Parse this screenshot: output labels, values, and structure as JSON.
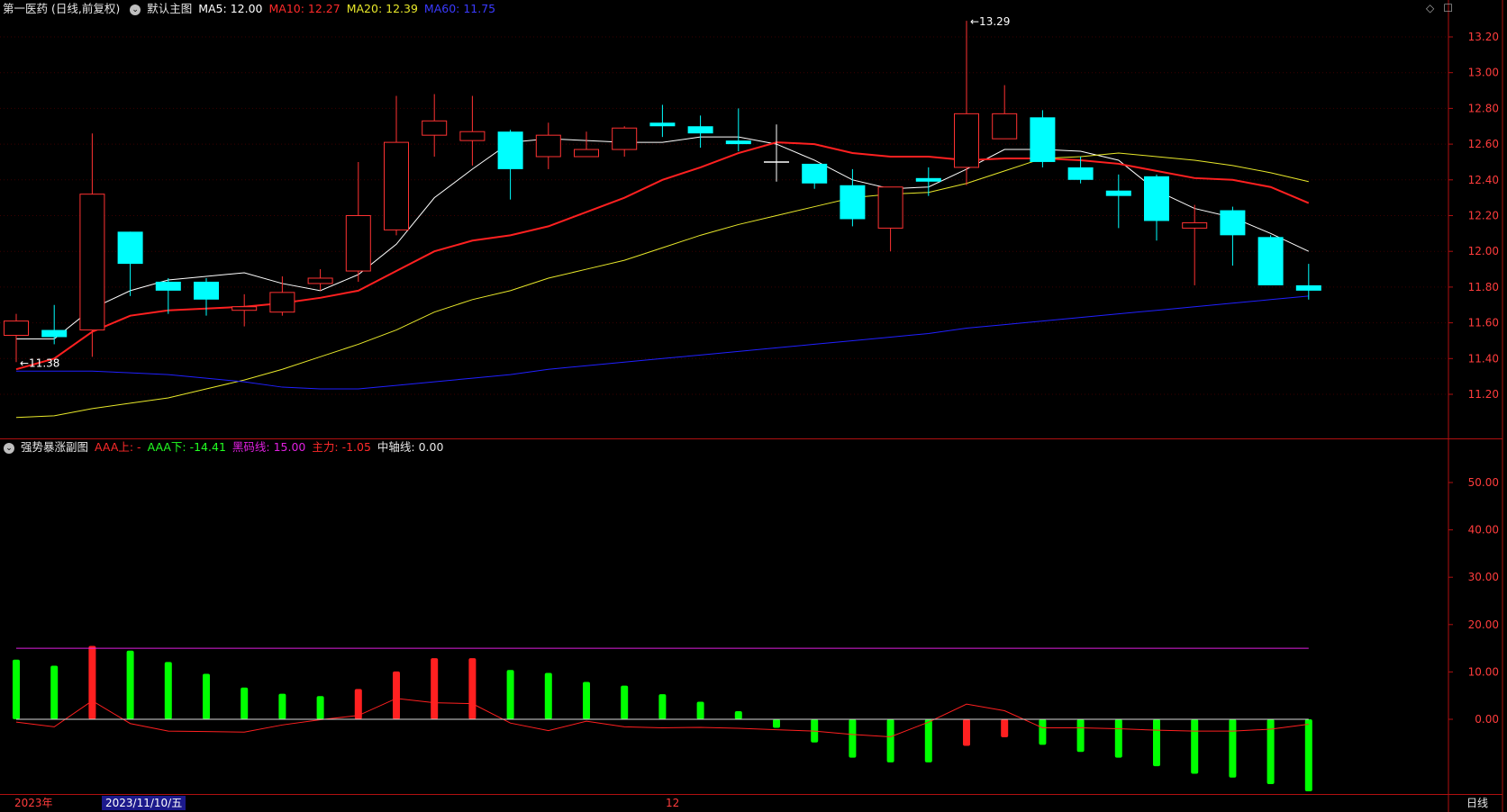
{
  "main_header": {
    "title": "第一医药 (日线,前复权)",
    "panel": "默认主图",
    "ma5": "MA5: 12.00",
    "ma10": "MA10: 12.27",
    "ma20": "MA20: 12.39",
    "ma60": "MA60: 11.75"
  },
  "sub_header": {
    "title": "强势暴涨副图",
    "aaa_up": "AAA上: -",
    "aaa_down": "AAA下: -14.41",
    "black_horse": "黑码线: 15.00",
    "main_force": "主力: -1.05",
    "mid_axis": "中轴线: 0.00"
  },
  "icons": [
    "diamond-icon",
    "square-icon"
  ],
  "x_axis": {
    "left": "2023年",
    "selected": "2023/11/10/五",
    "mid": "12",
    "right_tab": "日线"
  },
  "colors": {
    "up": "#ff3232",
    "down": "#00ffff",
    "ma5": "#ffffff",
    "ma10": "#ff2020",
    "ma20": "#e8e82a",
    "ma60": "#2020ff",
    "hist_up": "#ff2020",
    "hist_down": "#00ff00",
    "black_horse": "#e020e0",
    "axis_text": "#ff3c3c",
    "frame": "#b01010"
  },
  "chart_data": [
    {
      "type": "candlestick",
      "y_ticks": [
        "13.20",
        "13.00",
        "12.80",
        "12.60",
        "12.40",
        "12.20",
        "12.00",
        "11.80",
        "11.60",
        "11.40",
        "11.20"
      ],
      "ylim": [
        11.0,
        13.35
      ],
      "annotations": [
        {
          "label": "13.29",
          "index": 25,
          "price": 13.29
        },
        {
          "label": "11.38",
          "index": 0,
          "price": 11.38
        }
      ],
      "candles": [
        {
          "o": 11.53,
          "h": 11.65,
          "l": 11.38,
          "c": 11.61
        },
        {
          "o": 11.56,
          "h": 11.7,
          "l": 11.48,
          "c": 11.52
        },
        {
          "o": 11.56,
          "h": 12.66,
          "l": 11.41,
          "c": 12.32
        },
        {
          "o": 12.11,
          "h": 12.11,
          "l": 11.75,
          "c": 11.93
        },
        {
          "o": 11.83,
          "h": 11.85,
          "l": 11.65,
          "c": 11.78
        },
        {
          "o": 11.83,
          "h": 11.85,
          "l": 11.64,
          "c": 11.73
        },
        {
          "o": 11.67,
          "h": 11.76,
          "l": 11.58,
          "c": 11.69
        },
        {
          "o": 11.66,
          "h": 11.86,
          "l": 11.64,
          "c": 11.77
        },
        {
          "o": 11.82,
          "h": 11.9,
          "l": 11.78,
          "c": 11.85
        },
        {
          "o": 11.89,
          "h": 12.5,
          "l": 11.83,
          "c": 12.2
        },
        {
          "o": 12.12,
          "h": 12.87,
          "l": 12.09,
          "c": 12.61
        },
        {
          "o": 12.65,
          "h": 12.88,
          "l": 12.53,
          "c": 12.73
        },
        {
          "o": 12.62,
          "h": 12.87,
          "l": 12.48,
          "c": 12.67
        },
        {
          "o": 12.67,
          "h": 12.68,
          "l": 12.29,
          "c": 12.46
        },
        {
          "o": 12.53,
          "h": 12.72,
          "l": 12.46,
          "c": 12.65
        },
        {
          "o": 12.53,
          "h": 12.67,
          "l": 12.53,
          "c": 12.57
        },
        {
          "o": 12.57,
          "h": 12.7,
          "l": 12.53,
          "c": 12.69
        },
        {
          "o": 12.72,
          "h": 12.82,
          "l": 12.64,
          "c": 12.7
        },
        {
          "o": 12.7,
          "h": 12.76,
          "l": 12.58,
          "c": 12.66
        },
        {
          "o": 12.62,
          "h": 12.8,
          "l": 12.56,
          "c": 12.6
        },
        {
          "o": 12.5,
          "h": 12.71,
          "l": 12.39,
          "c": 12.5
        },
        {
          "o": 12.49,
          "h": 12.49,
          "l": 12.35,
          "c": 12.38
        },
        {
          "o": 12.37,
          "h": 12.46,
          "l": 12.14,
          "c": 12.18
        },
        {
          "o": 12.13,
          "h": 12.36,
          "l": 12.0,
          "c": 12.36
        },
        {
          "o": 12.41,
          "h": 12.47,
          "l": 12.31,
          "c": 12.39
        },
        {
          "o": 12.47,
          "h": 13.29,
          "l": 12.37,
          "c": 12.77
        },
        {
          "o": 12.63,
          "h": 12.93,
          "l": 12.63,
          "c": 12.77
        },
        {
          "o": 12.75,
          "h": 12.79,
          "l": 12.47,
          "c": 12.5
        },
        {
          "o": 12.47,
          "h": 12.53,
          "l": 12.38,
          "c": 12.4
        },
        {
          "o": 12.34,
          "h": 12.43,
          "l": 12.13,
          "c": 12.31
        },
        {
          "o": 12.42,
          "h": 12.43,
          "l": 12.06,
          "c": 12.17
        },
        {
          "o": 12.13,
          "h": 12.26,
          "l": 11.81,
          "c": 12.16
        },
        {
          "o": 12.23,
          "h": 12.25,
          "l": 11.92,
          "c": 12.09
        },
        {
          "o": 12.08,
          "h": 12.09,
          "l": 11.81,
          "c": 11.81
        },
        {
          "o": 11.81,
          "h": 11.93,
          "l": 11.73,
          "c": 11.78
        }
      ],
      "series": [
        {
          "name": "MA5",
          "values": [
            11.51,
            11.51,
            11.68,
            11.78,
            11.84,
            11.86,
            11.88,
            11.82,
            11.78,
            11.87,
            12.04,
            12.3,
            12.46,
            12.61,
            12.63,
            12.62,
            12.61,
            12.61,
            12.64,
            12.64,
            12.6,
            12.51,
            12.4,
            12.35,
            12.36,
            12.46,
            12.57,
            12.57,
            12.56,
            12.51,
            12.34,
            12.24,
            12.19,
            12.1,
            12.0
          ]
        },
        {
          "name": "MA10",
          "values": [
            11.34,
            11.4,
            11.55,
            11.64,
            11.67,
            11.68,
            11.69,
            11.71,
            11.74,
            11.78,
            11.89,
            12.0,
            12.06,
            12.09,
            12.14,
            12.22,
            12.3,
            12.4,
            12.47,
            12.55,
            12.61,
            12.6,
            12.55,
            12.53,
            12.53,
            12.51,
            12.52,
            12.52,
            12.51,
            12.49,
            12.45,
            12.41,
            12.4,
            12.36,
            12.27
          ]
        },
        {
          "name": "MA20",
          "values": [
            11.07,
            11.08,
            11.12,
            11.15,
            11.18,
            11.23,
            11.28,
            11.34,
            11.41,
            11.48,
            11.56,
            11.66,
            11.73,
            11.78,
            11.85,
            11.9,
            11.95,
            12.02,
            12.09,
            12.15,
            12.2,
            12.25,
            12.3,
            12.32,
            12.33,
            12.38,
            12.45,
            12.52,
            12.53,
            12.55,
            12.53,
            12.51,
            12.48,
            12.44,
            12.39
          ]
        },
        {
          "name": "MA60",
          "values": [
            11.33,
            11.33,
            11.33,
            11.32,
            11.31,
            11.29,
            11.27,
            11.24,
            11.23,
            11.23,
            11.25,
            11.27,
            11.29,
            11.31,
            11.34,
            11.36,
            11.38,
            11.4,
            11.42,
            11.44,
            11.46,
            11.48,
            11.5,
            11.52,
            11.54,
            11.57,
            11.59,
            11.61,
            11.63,
            11.65,
            11.67,
            11.69,
            11.71,
            11.73,
            11.75
          ]
        }
      ]
    },
    {
      "type": "bar",
      "y_ticks": [
        "50.00",
        "40.00",
        "30.00",
        "20.00",
        "10.00",
        "0.00"
      ],
      "ylim": [
        -16,
        58
      ],
      "bars": [
        {
          "v": 12.6,
          "up": false
        },
        {
          "v": 11.3,
          "up": false
        },
        {
          "v": 15.5,
          "up": true
        },
        {
          "v": 14.5,
          "up": false
        },
        {
          "v": 12.1,
          "up": false
        },
        {
          "v": 9.6,
          "up": false
        },
        {
          "v": 6.7,
          "up": false
        },
        {
          "v": 5.4,
          "up": false
        },
        {
          "v": 4.9,
          "up": false
        },
        {
          "v": 6.4,
          "up": true
        },
        {
          "v": 10.1,
          "up": true
        },
        {
          "v": 12.9,
          "up": true
        },
        {
          "v": 12.9,
          "up": true
        },
        {
          "v": 10.4,
          "up": false
        },
        {
          "v": 9.8,
          "up": false
        },
        {
          "v": 7.9,
          "up": false
        },
        {
          "v": 7.1,
          "up": false
        },
        {
          "v": 5.3,
          "up": false
        },
        {
          "v": 3.7,
          "up": false
        },
        {
          "v": 1.7,
          "up": false
        },
        {
          "v": -1.8,
          "up": false
        },
        {
          "v": -4.9,
          "up": false
        },
        {
          "v": -8.1,
          "up": false
        },
        {
          "v": -9.1,
          "up": false
        },
        {
          "v": -9.1,
          "up": false
        },
        {
          "v": -5.6,
          "up": true
        },
        {
          "v": -3.8,
          "up": true
        },
        {
          "v": -5.4,
          "up": false
        },
        {
          "v": -6.9,
          "up": false
        },
        {
          "v": -8.1,
          "up": false
        },
        {
          "v": -9.9,
          "up": false
        },
        {
          "v": -11.5,
          "up": false
        },
        {
          "v": -12.3,
          "up": false
        },
        {
          "v": -13.7,
          "up": false
        },
        {
          "v": -15.2,
          "up": false
        }
      ],
      "series": [
        {
          "name": "黑码线",
          "values": [
            15,
            15,
            15,
            15,
            15,
            15,
            15,
            15,
            15,
            15,
            15,
            15,
            15,
            15,
            15,
            15,
            15,
            15,
            15,
            15,
            15,
            15,
            15,
            15,
            15,
            15,
            15,
            15,
            15,
            15,
            15,
            15,
            15,
            15,
            15
          ]
        },
        {
          "name": "主力",
          "values": [
            -0.6,
            -1.6,
            3.9,
            -0.9,
            -2.5,
            -2.6,
            -2.7,
            -1.2,
            -0.1,
            0.8,
            4.4,
            3.5,
            3.3,
            -0.8,
            -2.4,
            -0.4,
            -1.6,
            -1.8,
            -1.7,
            -1.9,
            -2.2,
            -2.5,
            -3.2,
            -3.7,
            -0.6,
            3.2,
            1.8,
            -1.8,
            -1.8,
            -2.0,
            -2.3,
            -2.5,
            -2.5,
            -2.1,
            -1.05
          ]
        },
        {
          "name": "中轴线",
          "values": [
            0,
            0,
            0,
            0,
            0,
            0,
            0,
            0,
            0,
            0,
            0,
            0,
            0,
            0,
            0,
            0,
            0,
            0,
            0,
            0,
            0,
            0,
            0,
            0,
            0,
            0,
            0,
            0,
            0,
            0,
            0,
            0,
            0,
            0,
            0
          ]
        }
      ]
    }
  ]
}
